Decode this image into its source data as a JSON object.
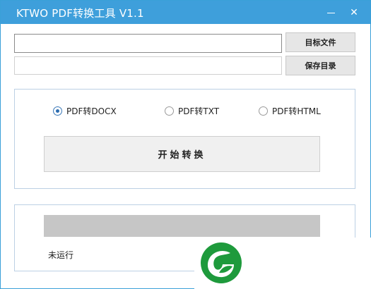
{
  "window": {
    "title": "KTWO PDF转换工具 V1.1",
    "minimize_icon": "minimize-icon",
    "close_icon": "close-icon",
    "close_glyph": "✕",
    "title_bar_color": "#3e9fdb"
  },
  "inputs": {
    "target_file_value": "",
    "save_dir_value": ""
  },
  "buttons": {
    "target_file": "目标文件",
    "save_dir": "保存目录",
    "start": "开始转换"
  },
  "format_options": [
    {
      "label": "PDF转DOCX",
      "checked": true
    },
    {
      "label": "PDF转TXT",
      "checked": false
    },
    {
      "label": "PDF转HTML",
      "checked": false
    }
  ],
  "progress": {
    "value": 0
  },
  "status_text": "未运行",
  "logo": {
    "icon": "green-leaf-logo",
    "color": "#1e9a3c"
  }
}
